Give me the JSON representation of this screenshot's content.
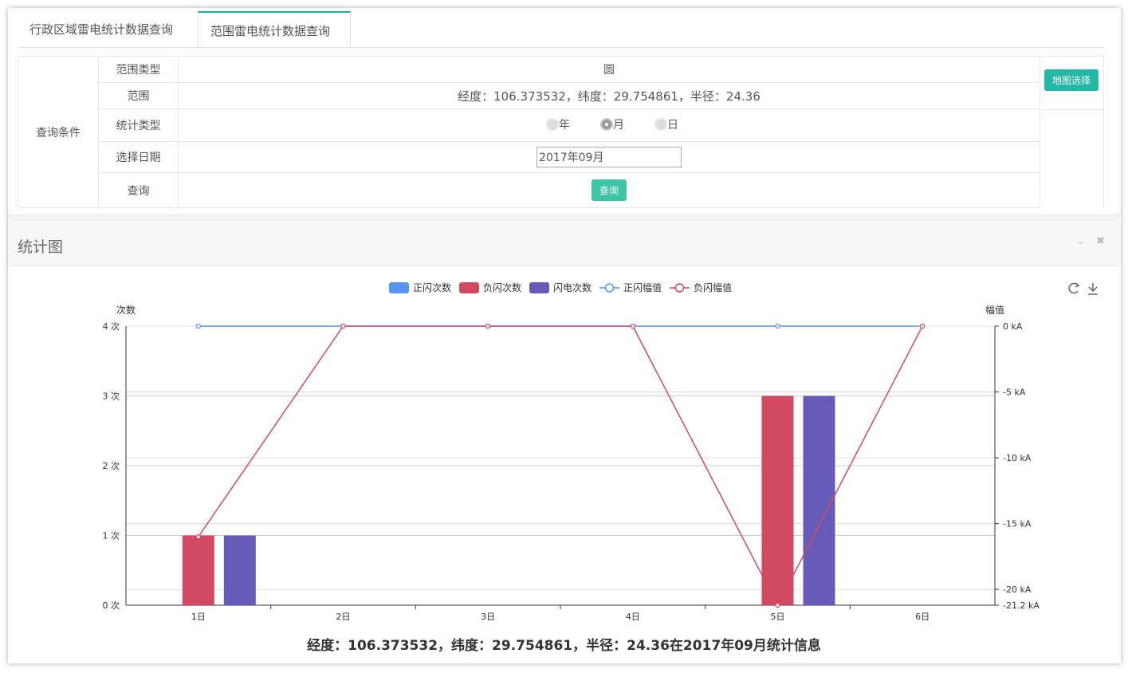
{
  "tabs": [
    {
      "label": "行政区域雷电统计数据查询"
    },
    {
      "label": "范围雷电统计数据查询"
    }
  ],
  "query": {
    "condition_label": "查询条件",
    "rows": {
      "range_type": {
        "label": "范围类型",
        "value": "圆"
      },
      "range": {
        "label": "范围",
        "value": "经度：106.373532，纬度：29.754861，半径：24.36"
      },
      "stat_type": {
        "label": "统计类型",
        "options": [
          "年",
          "月",
          "日"
        ],
        "selected": "月"
      },
      "date": {
        "label": "选择日期",
        "value": "2017年09月"
      },
      "submit": {
        "label": "查询",
        "button": "查询"
      }
    },
    "map_button": "地图选择"
  },
  "panel": {
    "title": "统计图",
    "tool_icons": [
      "chevron-down-icon",
      "close-icon"
    ]
  },
  "chart_toolbar": [
    "refresh-icon",
    "download-icon"
  ],
  "chart_data": {
    "type": "bar",
    "categories": [
      "1日",
      "2日",
      "3日",
      "4日",
      "5日",
      "6日"
    ],
    "series": [
      {
        "name": "正闪次数",
        "kind": "bar",
        "axis": "left",
        "color": "#5793f3",
        "values": [
          0,
          0,
          0,
          0,
          0,
          0
        ]
      },
      {
        "name": "负闪次数",
        "kind": "bar",
        "axis": "left",
        "color": "#d14a61",
        "values": [
          1,
          0,
          0,
          0,
          3,
          0
        ]
      },
      {
        "name": "闪电次数",
        "kind": "bar",
        "axis": "left",
        "color": "#675bba",
        "values": [
          1,
          0,
          0,
          0,
          3,
          0
        ]
      },
      {
        "name": "正闪幅值",
        "kind": "line",
        "axis": "right",
        "color": "#5793f3",
        "values": [
          0,
          0,
          0,
          0,
          0,
          0
        ]
      },
      {
        "name": "负闪幅值",
        "kind": "line",
        "axis": "right",
        "color": "#d14a61",
        "values": [
          -16,
          0,
          0,
          0,
          -21.2,
          0
        ]
      }
    ],
    "left_axis": {
      "label": "次数",
      "min": 0,
      "max": 4,
      "ticks": [
        "0 次",
        "1 次",
        "2 次",
        "3 次",
        "4 次"
      ]
    },
    "right_axis": {
      "label": "幅值",
      "min": -21.2,
      "max": 0,
      "ticks": [
        {
          "v": 0,
          "t": "0 kA"
        },
        {
          "v": -5,
          "t": "-5 kA"
        },
        {
          "v": -10,
          "t": "-10 kA"
        },
        {
          "v": -15,
          "t": "-15 kA"
        },
        {
          "v": -20,
          "t": "-20 kA"
        },
        {
          "v": -21.2,
          "t": "-21.2 kA"
        }
      ]
    },
    "legend_position": "top-center",
    "caption": "经度：106.373532，纬度：29.754861，半径：24.36在2017年09月统计信息"
  }
}
